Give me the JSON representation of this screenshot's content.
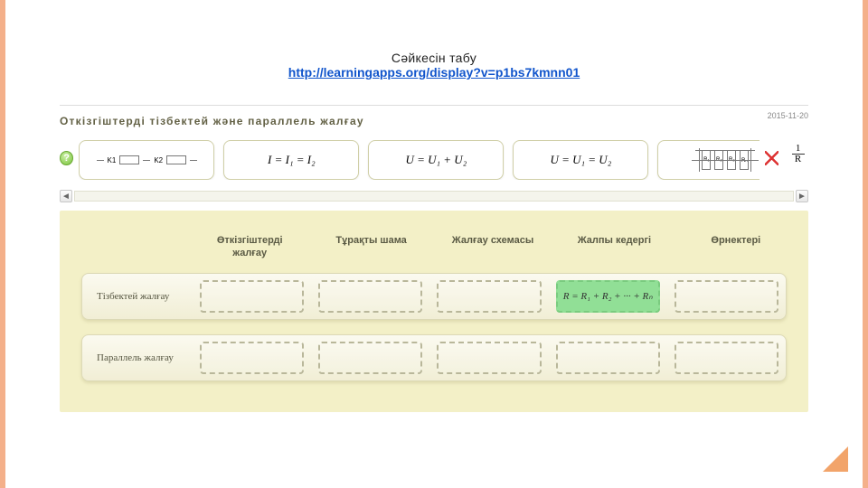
{
  "header": {
    "title": "Сәйкесін табу",
    "link_text": "http://learningapps.org/display?v=p1bs7kmnn01"
  },
  "app": {
    "title": "Откізгіштерді тізбектей және параллель жалғау",
    "date": "2015-11-20"
  },
  "options": {
    "card1": {
      "k1": "K1",
      "k2": "K2"
    },
    "card2": "I = I₁ = I₂",
    "card3": "U = U₁ + U₂",
    "card4": "U = U₁ = U₂",
    "card5": {
      "r1": "R₁",
      "r2": "R₂",
      "r3": "R₃",
      "rn": "Rₙ"
    },
    "fraction_top": "1",
    "fraction_bottom": "R"
  },
  "columns": {
    "c1": "Өткізгіштерді жалғау",
    "c2": "Тұрақты шама",
    "c3": "Жалғау схемасы",
    "c4": "Жалпы кедергі",
    "c5": "Өрнектері"
  },
  "rows": {
    "r1": {
      "label": "Тізбектей жалғау",
      "filled_index": 3,
      "filled_value": "R = R₁ + R₂ + ··· + Rₙ"
    },
    "r2": {
      "label": "Параллель жалғау"
    }
  }
}
